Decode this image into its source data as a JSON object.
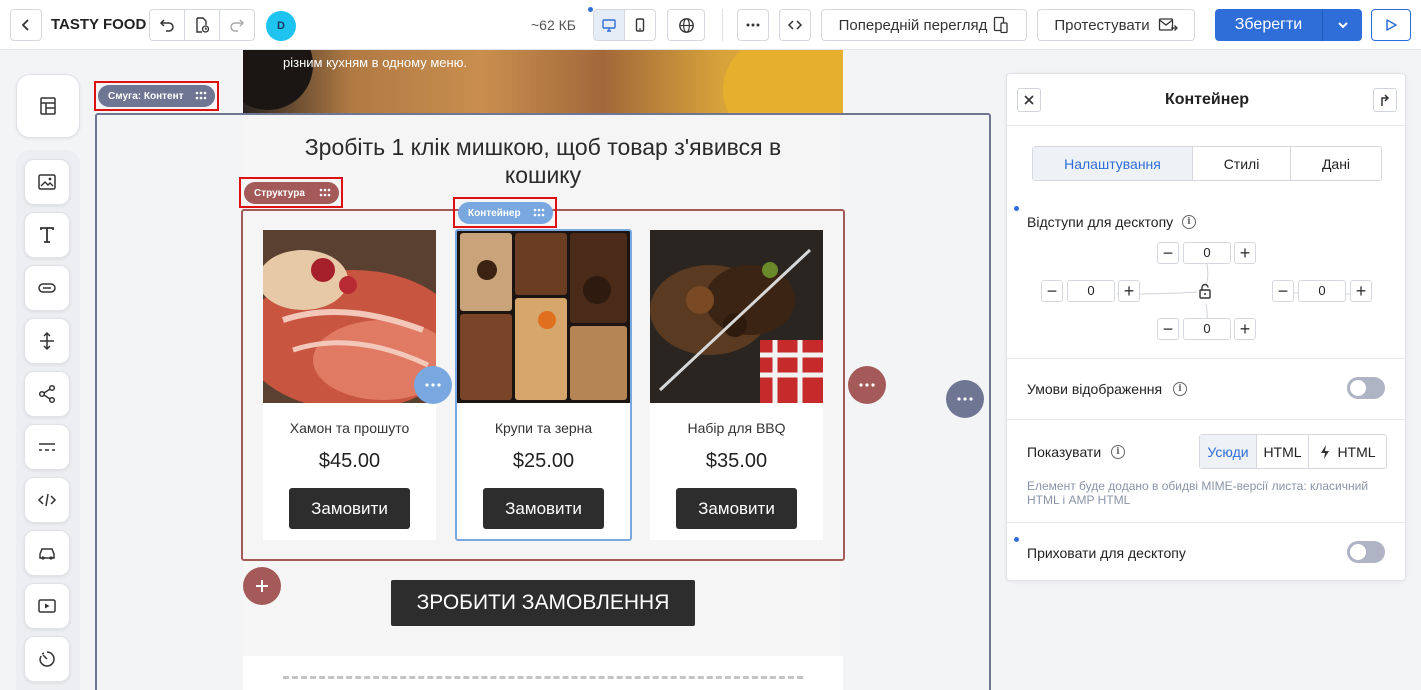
{
  "topbar": {
    "title": "TASTY FOOD",
    "avatar_letter": "D",
    "size": "~62 КБ",
    "preview_label": "Попередній перегляд",
    "test_label": "Протестувати",
    "save_label": "Зберегти"
  },
  "canvas": {
    "hero_text": "різним кухням в одному меню.",
    "headline": "Зробіть 1 клік мишкою, щоб товар з'явився в кошику",
    "badges": {
      "stripe": "Смуга: Контент",
      "structure": "Структура",
      "container": "Контейнер"
    },
    "products": [
      {
        "name": "Хамон та прошуто",
        "price": "$45.00",
        "button": "Замовити"
      },
      {
        "name": "Крупи та зерна",
        "price": "$25.00",
        "button": "Замовити"
      },
      {
        "name": "Набір для BBQ",
        "price": "$35.00",
        "button": "Замовити"
      }
    ],
    "order_all": "ЗРОБИТИ ЗАМОВЛЕННЯ"
  },
  "panel": {
    "title": "Контейнер",
    "tabs": [
      "Налаштування",
      "Стилі",
      "Дані"
    ],
    "active_tab": "Налаштування",
    "padding_label": "Відступи для десктопу",
    "padding": {
      "top": "0",
      "left": "0",
      "right": "0",
      "bottom": "0"
    },
    "display_conditions_label": "Умови відображення",
    "show_label": "Показувати",
    "show_options": [
      "Усюди",
      "HTML",
      "HTML"
    ],
    "show_selected": "Усюди",
    "show_note": "Елемент буде додано в обидві MIME-версії листа: класичний HTML і AMP HTML",
    "hide_desktop_label": "Приховати для десктопу",
    "display_conditions_on": false,
    "hide_desktop_on": false
  },
  "colors": {
    "accent": "#2f6ed8",
    "structure": "#a55a5a",
    "stripe": "#6e7694",
    "container": "#79a8e0",
    "highlight": "#e01010"
  }
}
